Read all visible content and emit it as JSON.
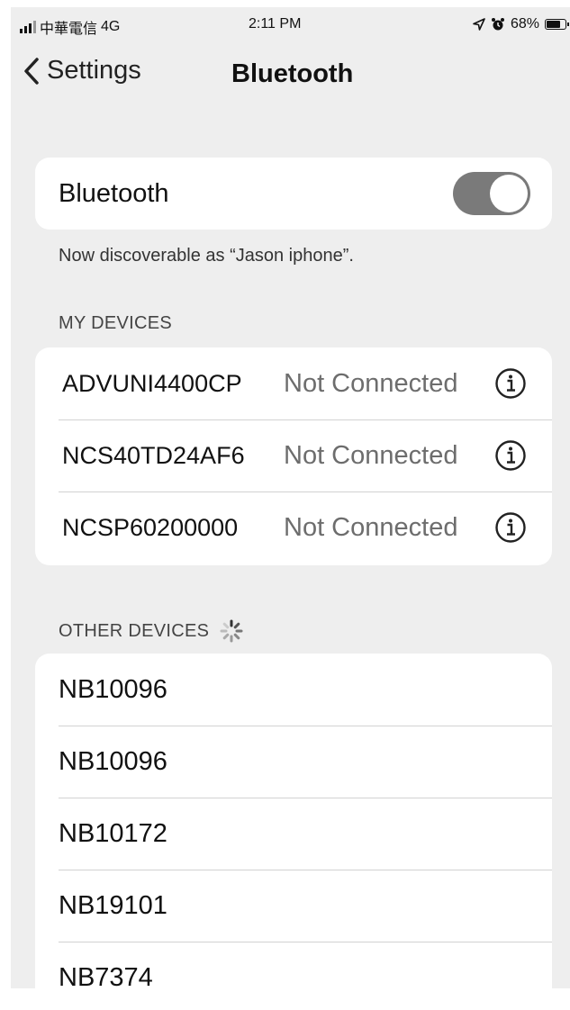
{
  "status_bar": {
    "carrier": "中華電信",
    "network": "4G",
    "time": "2:11 PM",
    "battery": "68%",
    "icons": [
      "signal-icon",
      "location-icon",
      "alarm-icon",
      "battery-icon"
    ]
  },
  "nav": {
    "back_label": "Settings",
    "title": "Bluetooth"
  },
  "bluetooth": {
    "label": "Bluetooth",
    "enabled": true,
    "discoverable_text": "Now discoverable as “Jason iphone”."
  },
  "my_devices": {
    "header": "MY DEVICES",
    "items": [
      {
        "name": "ADVUNI4400CP",
        "status": "Not Connected"
      },
      {
        "name": "NCS40TD24AF6",
        "status": "Not Connected"
      },
      {
        "name": "NCSP60200000",
        "status": "Not Connected"
      }
    ]
  },
  "other_devices": {
    "header": "OTHER DEVICES",
    "searching": true,
    "items": [
      {
        "name": "NB10096"
      },
      {
        "name": "NB10096"
      },
      {
        "name": "NB10172"
      },
      {
        "name": "NB19101"
      },
      {
        "name": "NB7374"
      }
    ]
  },
  "colors": {
    "background": "#eeeeee",
    "card": "#ffffff",
    "toggle_on": "#7a7a7a",
    "secondary_text": "#6d6d6d"
  }
}
